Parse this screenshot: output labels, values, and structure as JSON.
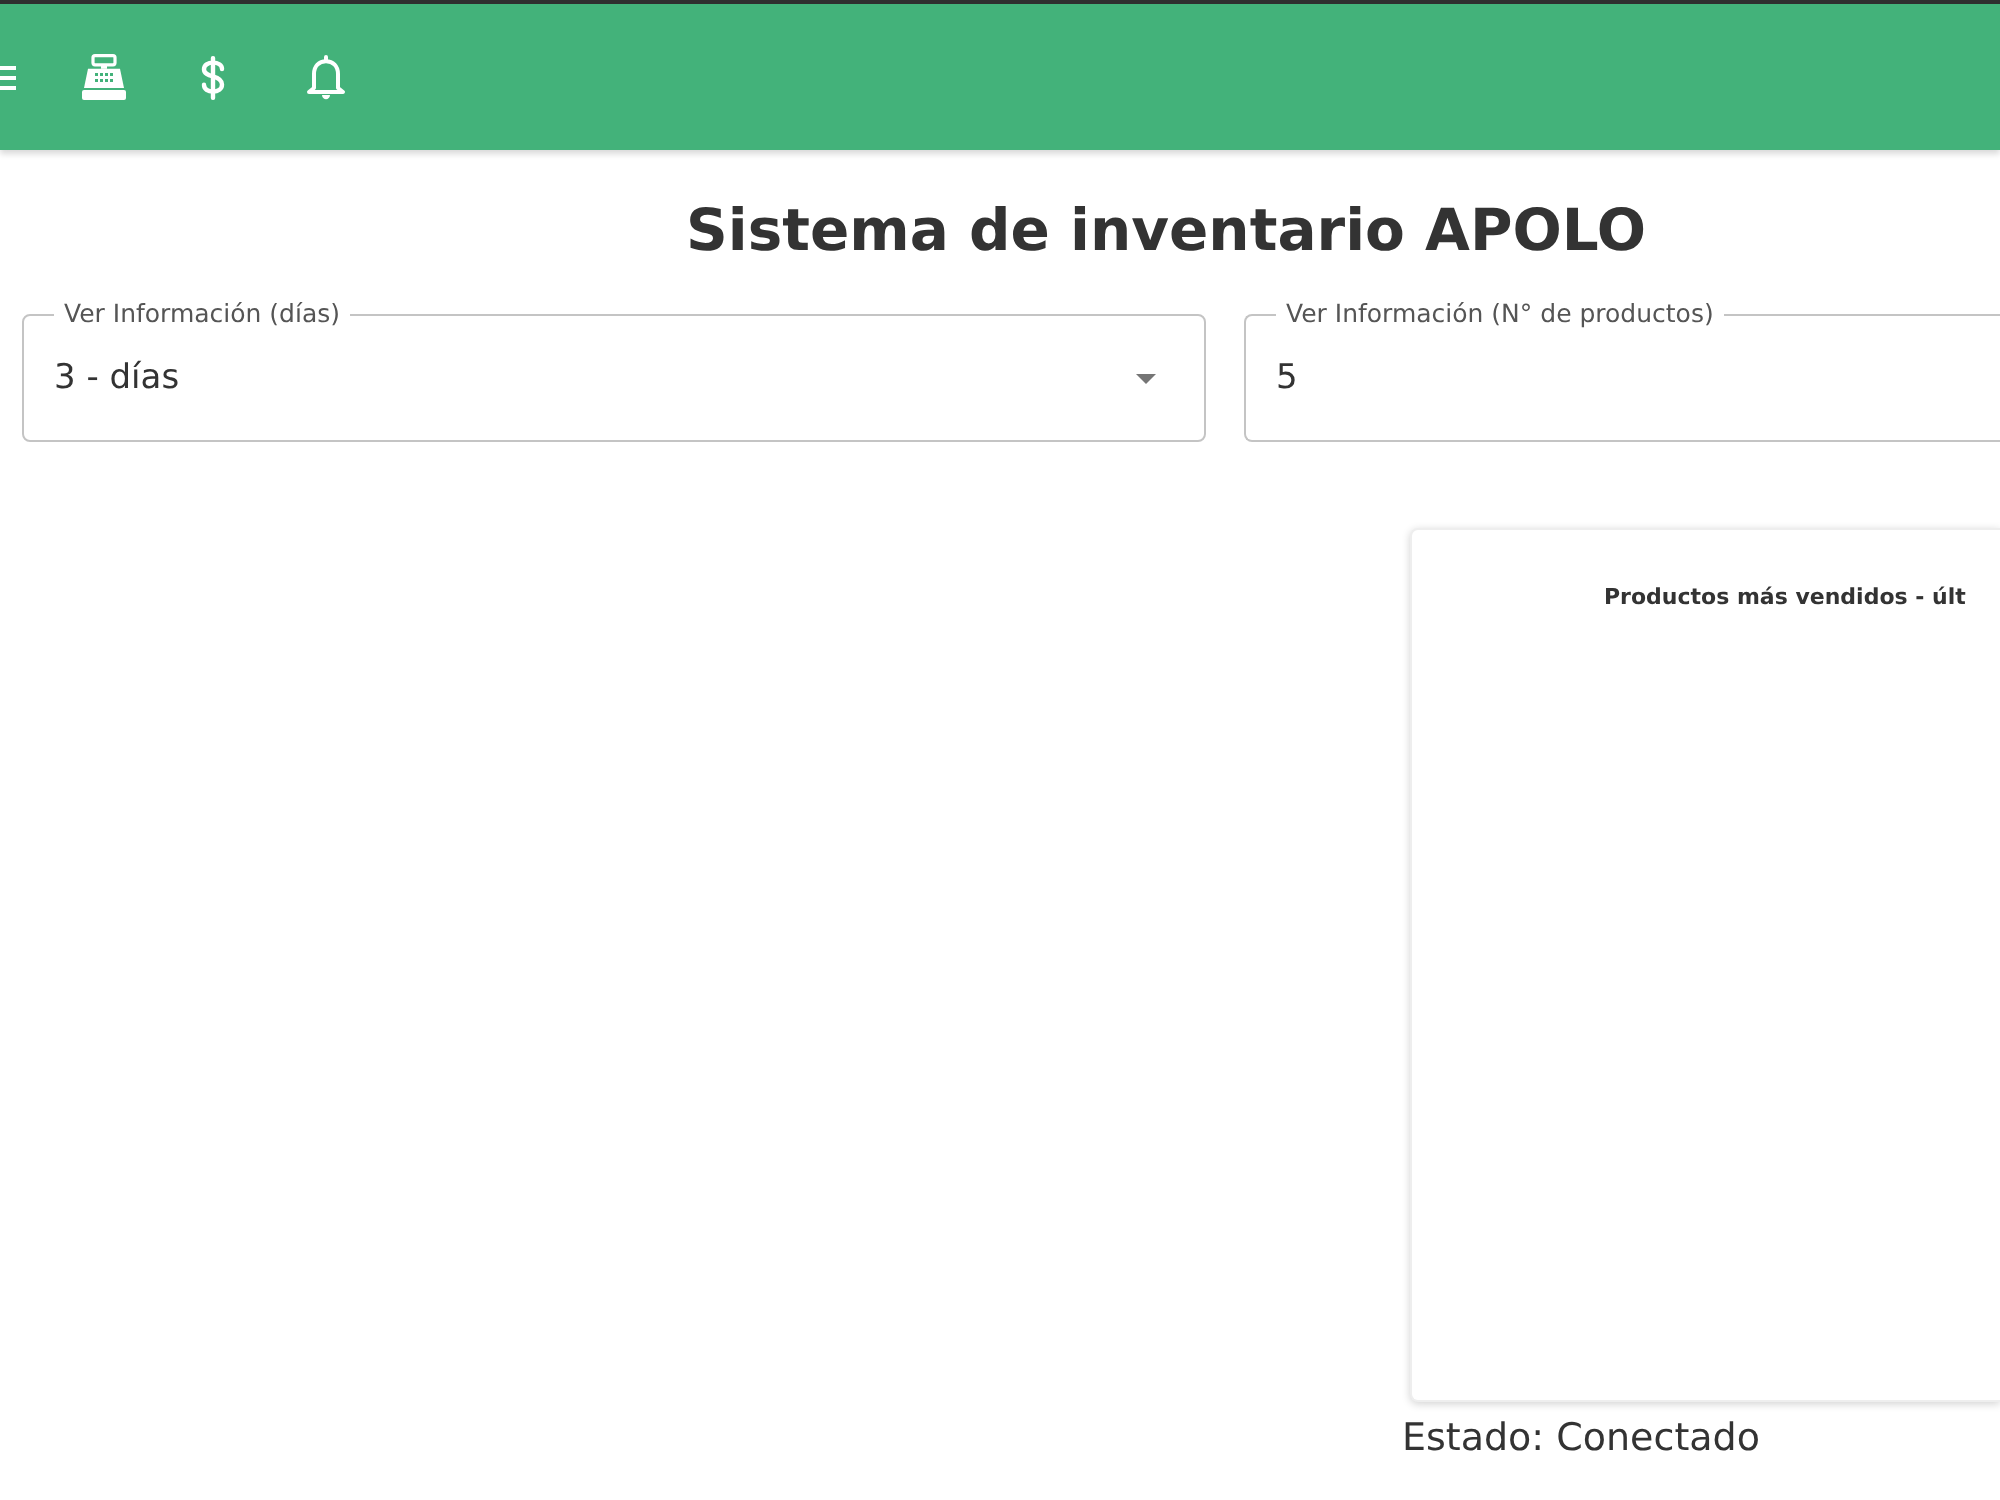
{
  "title": "Sistema de inventario APOLO",
  "filters": [
    {
      "kind": "select",
      "label": "Ver Información (días)",
      "value": "3 - días"
    },
    {
      "kind": "input",
      "label": "Ver Información (N° de productos)",
      "value": "5"
    }
  ],
  "chart_card": {
    "title": "Productos más vendidos - últ"
  },
  "status": "Estado: Conectado"
}
